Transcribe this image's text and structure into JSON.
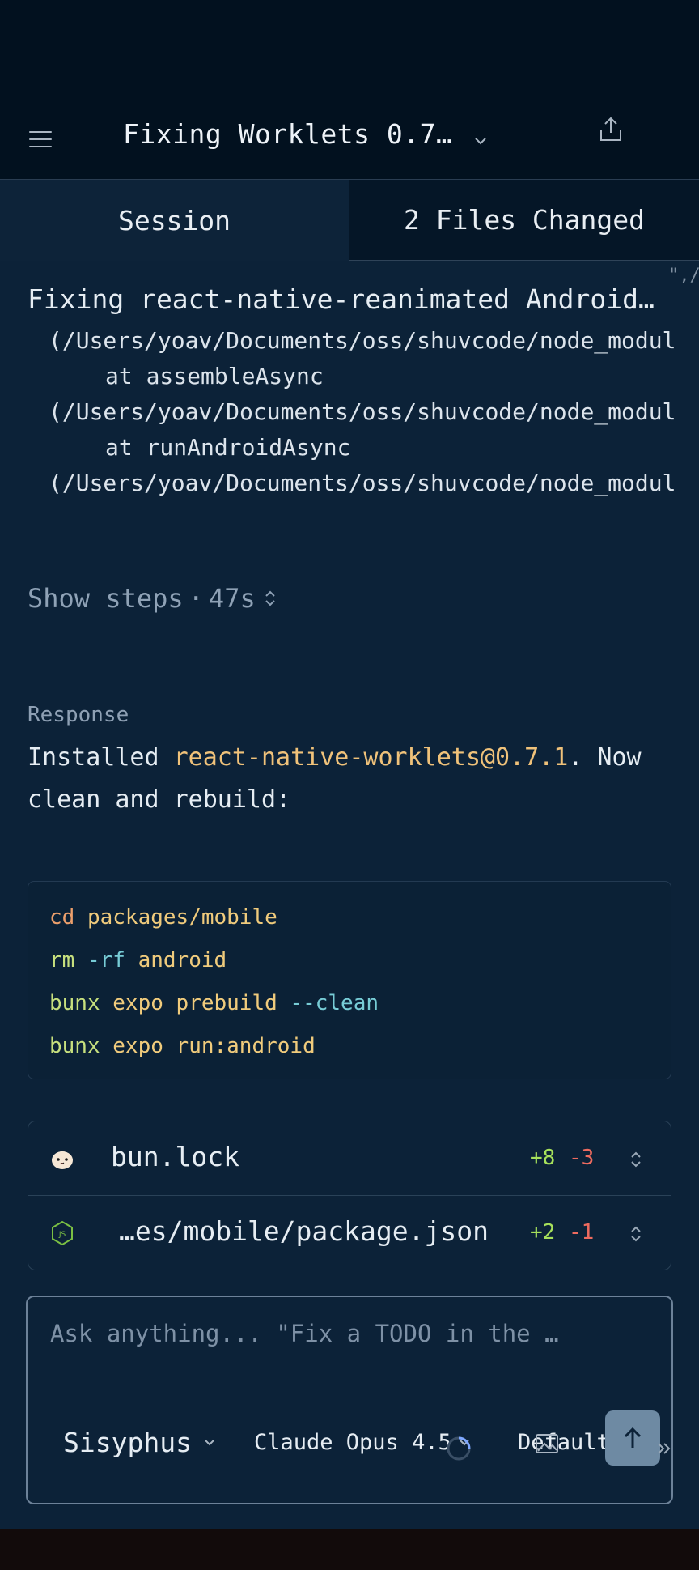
{
  "header": {
    "title": "Fixing Worklets 0.7…"
  },
  "tabs": [
    {
      "label": "Session"
    },
    {
      "label": "2 Files Changed"
    }
  ],
  "tool_output": {
    "corner_text": "\",/",
    "title": "Fixing react-native-reanimated Android…",
    "lines": [
      "(/Users/yoav/Documents/oss/shuvcode/node_modul",
      "at assembleAsync",
      "(/Users/yoav/Documents/oss/shuvcode/node_modul",
      "at runAndroidAsync",
      "(/Users/yoav/Documents/oss/shuvcode/node_modul"
    ]
  },
  "steps": {
    "label": "Show steps",
    "separator": "·",
    "duration": "47s"
  },
  "response": {
    "label": "Response",
    "text_before": "Installed ",
    "package": "react-native-worklets@0.7.1",
    "text_after": ". Now clean and rebuild:"
  },
  "code": {
    "lines": [
      [
        {
          "t": "cd",
          "c": "orange"
        },
        {
          "t": " packages/mobile",
          "c": "yellow"
        }
      ],
      [
        {
          "t": "rm",
          "c": "green"
        },
        {
          "t": " -rf",
          "c": "cyan"
        },
        {
          "t": " android",
          "c": "yellow"
        }
      ],
      [
        {
          "t": "bunx",
          "c": "green"
        },
        {
          "t": " expo prebuild",
          "c": "yellow"
        },
        {
          "t": " --clean",
          "c": "cyan"
        }
      ],
      [
        {
          "t": "bunx",
          "c": "green"
        },
        {
          "t": " expo run:android",
          "c": "yellow"
        }
      ]
    ]
  },
  "files": [
    {
      "name": "bun.lock",
      "additions": "+8",
      "deletions": "-3",
      "icon": "bun-icon"
    },
    {
      "name": "…es/mobile/package.json",
      "additions": "+2",
      "deletions": "-1",
      "icon": "nodejs-icon"
    }
  ],
  "composer": {
    "placeholder": "Ask anything... \"Fix a TODO in the …",
    "agent": "Sisyphus",
    "model": "Claude Opus 4.5",
    "variant": "Default"
  },
  "colors": {
    "background": "#0c2238",
    "header": "#02111f",
    "accent_package": "#f0c27a",
    "additions": "#a7e15b",
    "deletions": "#ee6b5f",
    "send_button": "#6e8aa3"
  }
}
